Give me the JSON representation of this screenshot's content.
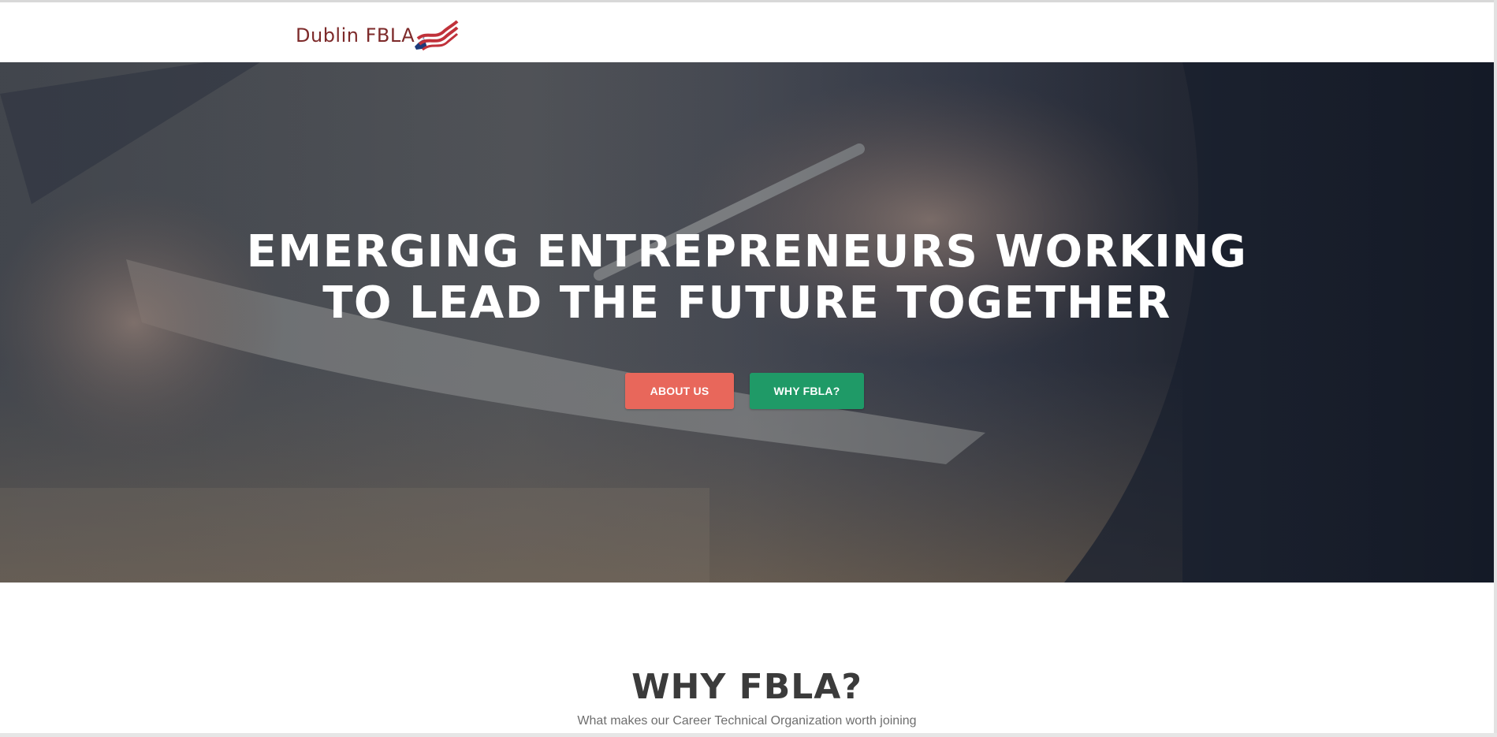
{
  "navbar": {
    "brand": {
      "text": "Dublin FBLA",
      "icon": "flag-stripes-icon"
    }
  },
  "hero": {
    "title_line1": "EMERGING ENTREPRENEURS WORKING",
    "title_line2": "TO LEAD THE FUTURE TOGETHER",
    "buttons": {
      "about_label": "ABOUT US",
      "why_label": "WHY FBLA?"
    }
  },
  "why_section": {
    "title": "WHY FBLA?",
    "subtitle": "What makes our Career Technical Organization worth joining"
  },
  "colors": {
    "brand_text": "#7d2a2a",
    "flag_red": "#c0313a",
    "flag_navy": "#1d3a7a",
    "about_button": "#e8675b",
    "why_button": "#1f9a67",
    "heading_text": "#3b3b3b",
    "subtitle_text": "#6e6e6e"
  }
}
